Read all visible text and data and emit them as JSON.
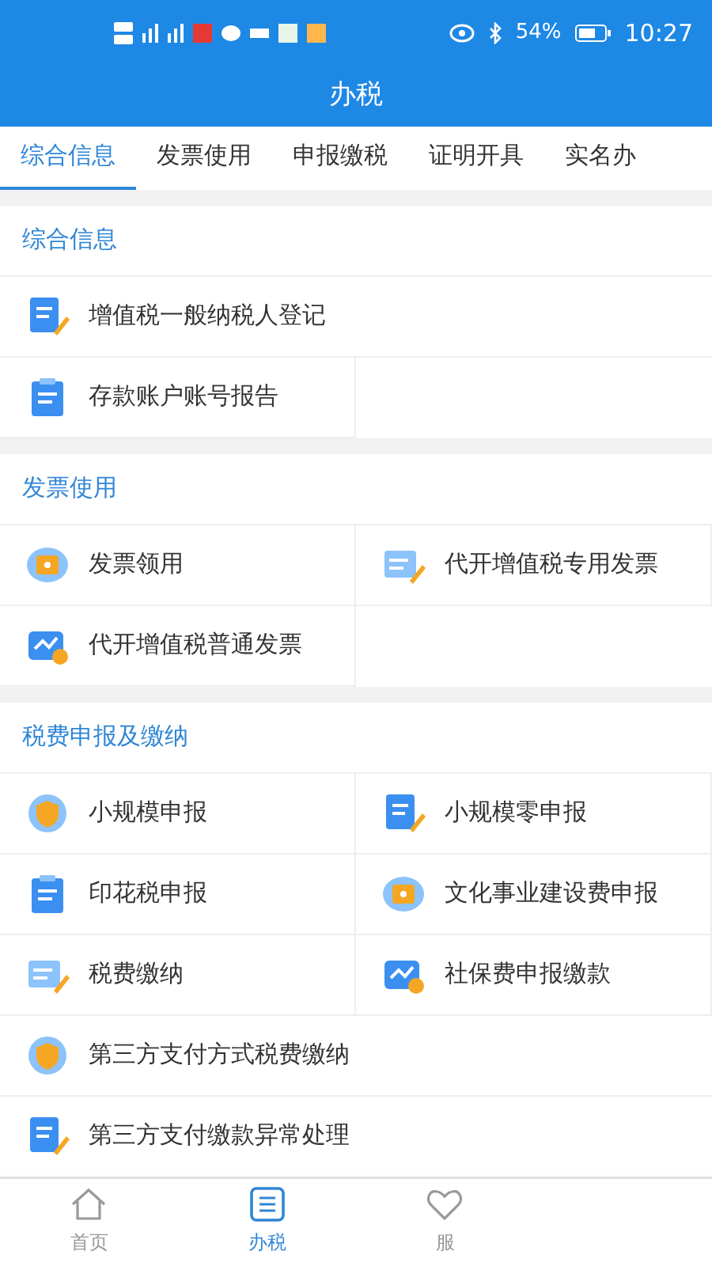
{
  "status_bar": {
    "battery": "54%",
    "time": "10:27"
  },
  "title": "办税",
  "tabs": [
    {
      "label": "综合信息",
      "selected": true
    },
    {
      "label": "发票使用",
      "selected": false
    },
    {
      "label": "申报缴税",
      "selected": false
    },
    {
      "label": "证明开具",
      "selected": false
    },
    {
      "label": "实名办",
      "selected": false
    }
  ],
  "sections": [
    {
      "title": "综合信息",
      "items": [
        {
          "label": "增值税一般纳税人登记",
          "wide": true
        },
        {
          "label": "存款账户账号报告",
          "wide": false
        }
      ]
    },
    {
      "title": "发票使用",
      "items": [
        {
          "label": "发票领用",
          "wide": false
        },
        {
          "label": "代开增值税专用发票",
          "wide": false
        },
        {
          "label": "代开增值税普通发票",
          "wide": false
        }
      ]
    },
    {
      "title": "税费申报及缴纳",
      "items": [
        {
          "label": "小规模申报",
          "wide": false
        },
        {
          "label": "小规模零申报",
          "wide": false
        },
        {
          "label": "印花税申报",
          "wide": false
        },
        {
          "label": "文化事业建设费申报",
          "wide": false
        },
        {
          "label": "税费缴纳",
          "wide": false
        },
        {
          "label": "社保费申报缴款",
          "wide": false
        },
        {
          "label": "第三方支付方式税费缴纳",
          "wide": true
        },
        {
          "label": "第三方支付缴款异常处理",
          "wide": true
        }
      ]
    }
  ],
  "bottom_nav": [
    {
      "label": "首页",
      "selected": false
    },
    {
      "label": "办税",
      "selected": true
    },
    {
      "label": "服",
      "selected": false
    }
  ]
}
